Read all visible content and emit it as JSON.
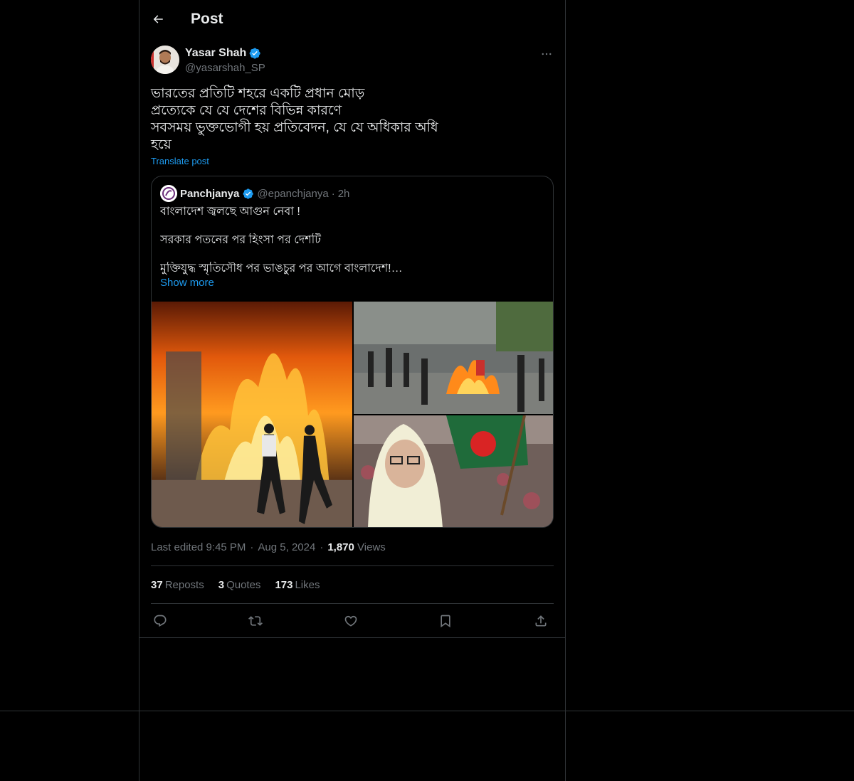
{
  "header": {
    "title": "Post"
  },
  "post": {
    "author_name": "Yasar Shah",
    "author_handle": "@yasarshah_SP",
    "text": "ভারতের প্রতিটি শহরে একটি প্রধান মোড়\nপ্রত্যেকে যে যে দেশের বিভিন্ন কারণে\nসবসময় ভুক্তভোগী হয় প্রতিবেদন, যে যে অধিকার অধি\nহয়ে",
    "translate_label": "Translate post"
  },
  "quote": {
    "name": "Panchjanya",
    "handle": "@epanchjanya",
    "dot": "·",
    "time": "2h",
    "lines": [
      "বাংলাদেশ জ্বলছে আগুন নেবা !",
      "সরকার পতনের পর হিংসা পর দেশটি",
      "মুক্তিযুদ্ধ স্মৃতিসৌধ পর ভাঙচুর পর আগে বাংলাদেশ!…"
    ],
    "show_more": "Show more"
  },
  "meta": {
    "edited": "Last edited 9:45 PM",
    "dot": "·",
    "date": "Aug 5, 2024",
    "views_count": "1,870",
    "views_label": "Views"
  },
  "stats": {
    "reposts_count": "37",
    "reposts_label": "Reposts",
    "quotes_count": "3",
    "quotes_label": "Quotes",
    "likes_count": "173",
    "likes_label": "Likes"
  },
  "colors": {
    "accent": "#1d9bf0",
    "verified": "#1d9bf0",
    "background": "#000000",
    "border": "#2f3336",
    "muted": "#71767b"
  },
  "icons": [
    "back-arrow-icon",
    "verified-badge-icon",
    "more-options-icon",
    "reply-icon",
    "repost-icon",
    "like-icon",
    "bookmark-icon",
    "share-icon"
  ]
}
